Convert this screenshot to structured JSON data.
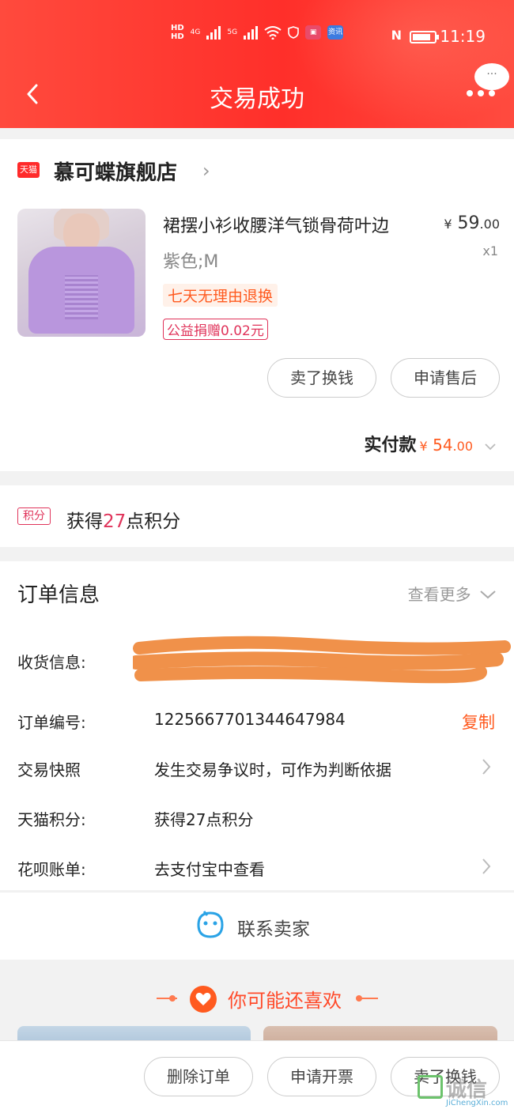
{
  "status_bar": {
    "time": "11:19",
    "hd1": "HD",
    "hd2": "HD",
    "net1": "4G",
    "net2": "5G",
    "app_label": "资讯",
    "nfc": "N"
  },
  "header": {
    "title": "交易成功",
    "back_icon": "chevron-left-icon",
    "more_icon": "more-dots-icon",
    "bubble_text": "···"
  },
  "shop": {
    "badge": "天猫",
    "name": "慕可蝶旗舰店",
    "chevron": "›"
  },
  "product": {
    "title": "裙摆小衫收腰洋气锁骨荷叶边",
    "price_symbol": "¥",
    "price_int": "59",
    "price_dec": ".00",
    "quantity": "x1",
    "sku": "紫色;M",
    "tag_return": "七天无理由退换",
    "tag_charity": "公益捐赠0.02元"
  },
  "actions": {
    "sell": "卖了换钱",
    "after_sale": "申请售后"
  },
  "paid": {
    "label": "实付款",
    "symbol": "¥",
    "amount_int": "54",
    "amount_dec": ".00"
  },
  "points": {
    "tag": "积分",
    "prefix": "获得",
    "count": "27",
    "suffix": "点积分"
  },
  "order_info": {
    "title": "订单信息",
    "more": "查看更多",
    "rows": [
      {
        "label": "收货信息:",
        "value": ""
      },
      {
        "label": "订单编号:",
        "value": "1225667701344647984"
      },
      {
        "label": "交易快照",
        "value": "发生交易争议时，可作为判断依据"
      },
      {
        "label": "天猫积分:",
        "value": "获得27点积分"
      },
      {
        "label": "花呗账单:",
        "value": "去支付宝中查看"
      }
    ],
    "copy": "复制"
  },
  "contact": {
    "label": "联系卖家",
    "icon": "smiley-chat-icon"
  },
  "recommend": {
    "title": "你可能还喜欢"
  },
  "bottom": {
    "delete": "删除订单",
    "invoice": "申请开票",
    "sell": "卖了换钱"
  },
  "watermark": {
    "text": "诚信",
    "sub": "JiChengXin.com"
  },
  "colors": {
    "header_red": "#ff2f2a",
    "accent_orange": "#ff5a1f",
    "tmall_red": "#ff2a2a",
    "charity_pink": "#e0335a"
  }
}
